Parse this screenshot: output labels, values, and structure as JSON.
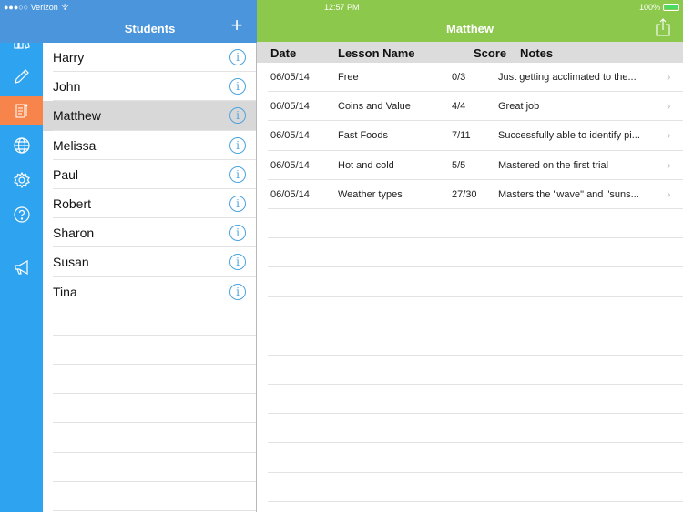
{
  "status_bar": {
    "carrier": "●●●○○ Verizon",
    "time": "12:57 PM",
    "battery": "100%"
  },
  "sidebar": {
    "items": [
      {
        "icon": "books-icon",
        "active": false
      },
      {
        "icon": "pencil-icon",
        "active": false
      },
      {
        "icon": "report-icon",
        "active": true
      },
      {
        "icon": "globe-icon",
        "active": false
      },
      {
        "icon": "gear-icon",
        "active": false
      },
      {
        "icon": "help-icon",
        "active": false
      },
      {
        "icon": "megaphone-icon",
        "active": false
      }
    ]
  },
  "students_panel": {
    "title": "Students",
    "add_label": "+",
    "selected": "Matthew",
    "students": [
      "Harry",
      "John",
      "Matthew",
      "Melissa",
      "Paul",
      "Robert",
      "Sharon",
      "Susan",
      "Tina"
    ]
  },
  "detail_panel": {
    "title": "Matthew",
    "columns": {
      "date": "Date",
      "lesson": "Lesson Name",
      "score": "Score",
      "notes": "Notes"
    },
    "rows": [
      {
        "date": "06/05/14",
        "lesson": "Free",
        "score": "0/3",
        "notes": "Just getting acclimated to the..."
      },
      {
        "date": "06/05/14",
        "lesson": "Coins and Value",
        "score": "4/4",
        "notes": "Great job"
      },
      {
        "date": "06/05/14",
        "lesson": "Fast Foods",
        "score": "7/11",
        "notes": "Successfully able to identify pi..."
      },
      {
        "date": "06/05/14",
        "lesson": "Hot and cold",
        "score": "5/5",
        "notes": "Mastered on the first trial"
      },
      {
        "date": "06/05/14",
        "lesson": "Weather types",
        "score": "27/30",
        "notes": "Masters the \"wave\" and \"suns..."
      }
    ],
    "chevron": "›"
  },
  "colors": {
    "sidebar": "#2ea3ef",
    "sidebar_active": "#f7844a",
    "students_header": "#4a95db",
    "detail_header": "#8cc84b",
    "column_header": "#dcdcdc"
  }
}
